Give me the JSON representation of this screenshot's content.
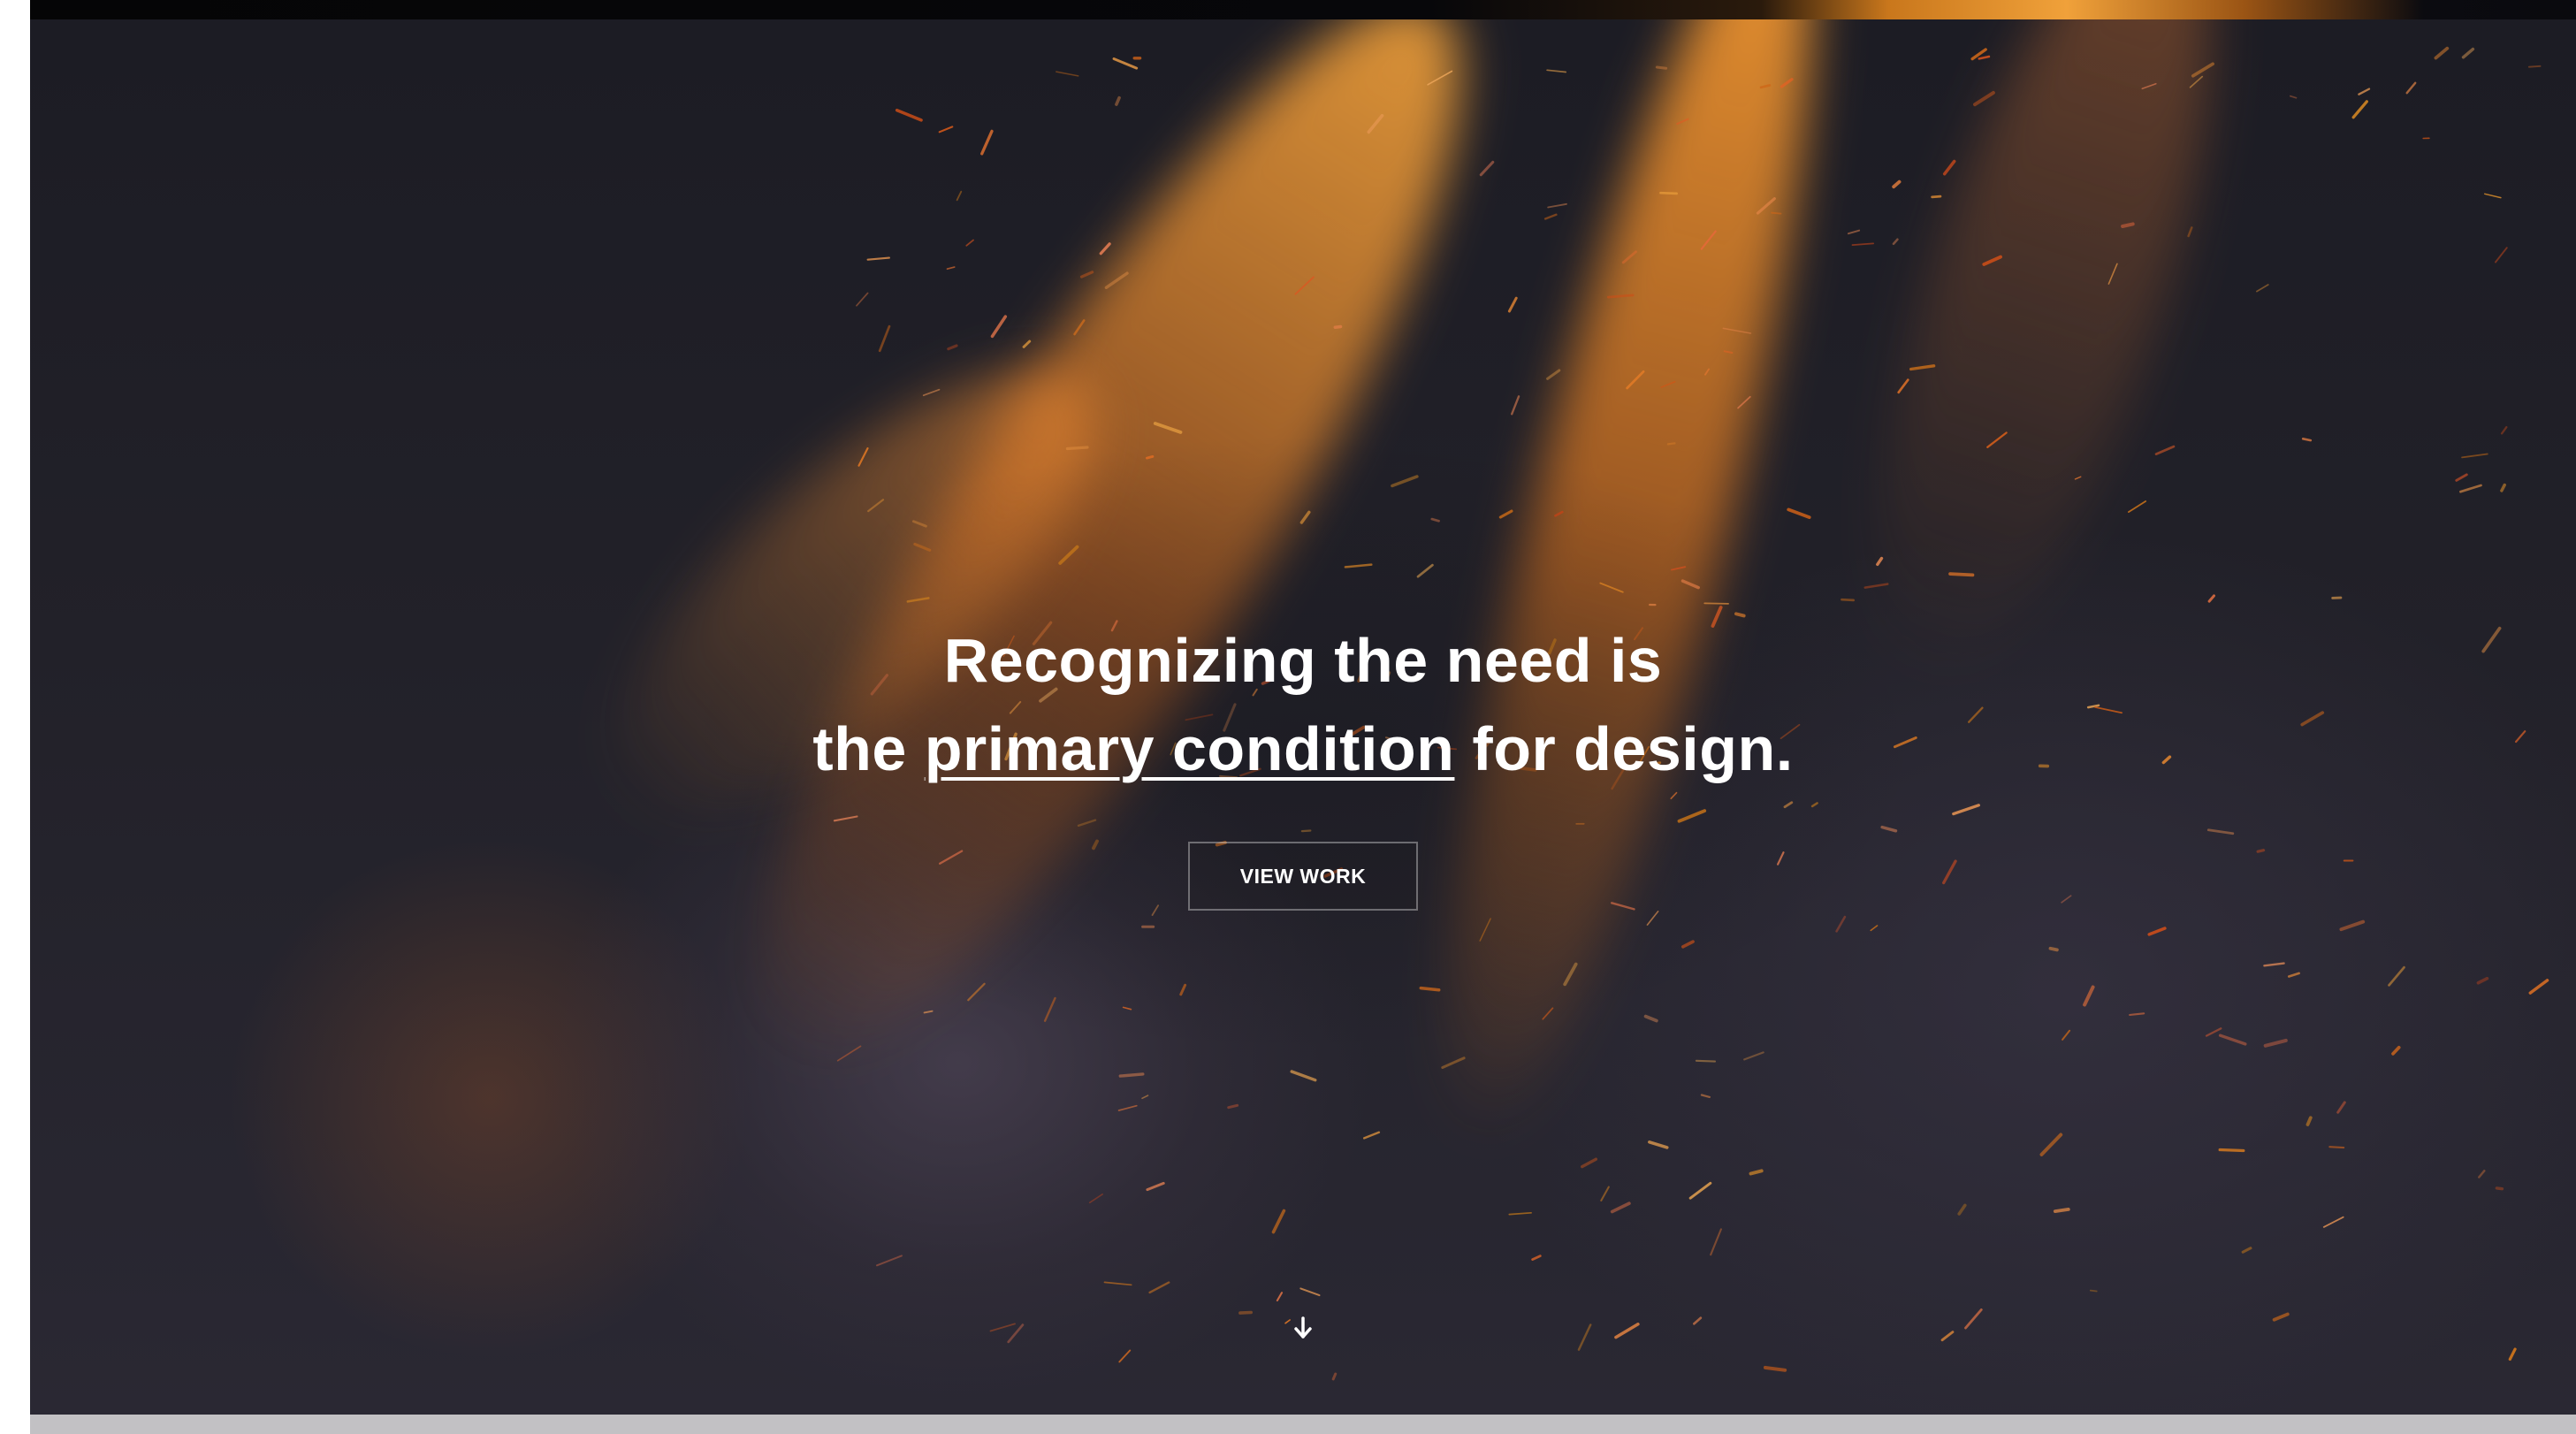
{
  "hero": {
    "headline": {
      "line1": "Recognizing the need is",
      "line2_prefix": "the ",
      "line2_link": "primary condition",
      "line2_suffix": " for design."
    },
    "cta_label": "VIEW WORK",
    "scroll_icon": "arrow-down-icon",
    "background_image": "flaming-dandelion-with-sparks"
  },
  "colors": {
    "text": "#ffffff",
    "flame": "#f0a13a",
    "background": "#1e1d25"
  }
}
